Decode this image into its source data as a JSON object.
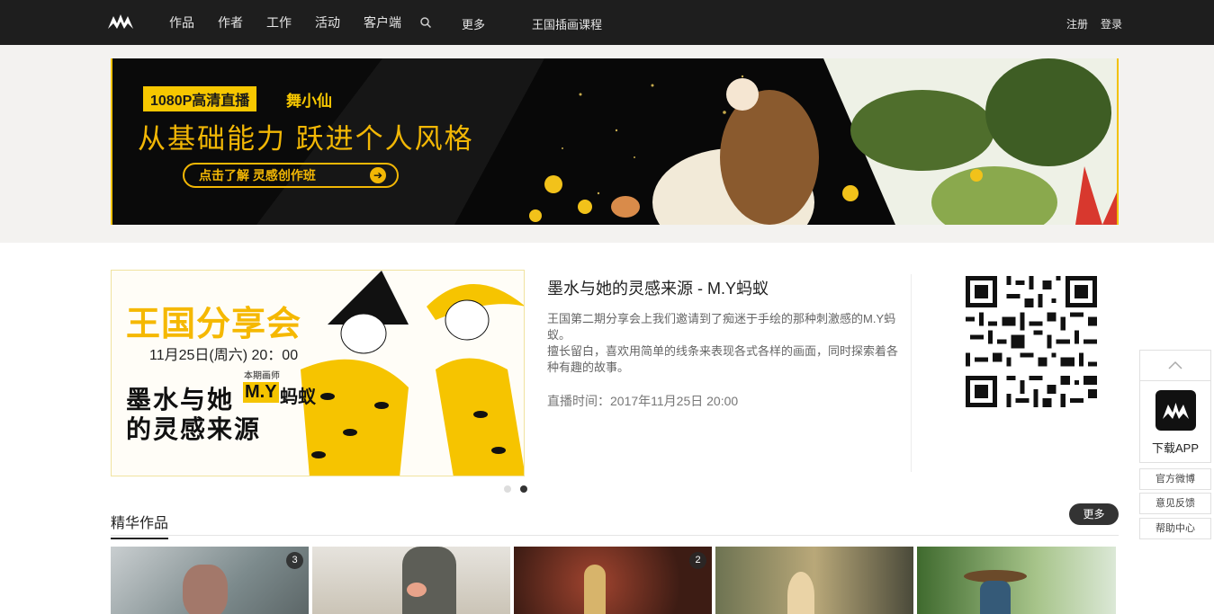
{
  "nav": {
    "logo_icon": "site-logo-icon",
    "items": [
      "作品",
      "作者",
      "工作",
      "活动",
      "客户端"
    ],
    "search_icon": "search-icon",
    "more": "更多",
    "course": "王国插画课程",
    "register": "注册",
    "login": "登录"
  },
  "banner": {
    "tag": "1080P高清直播",
    "author": "舞小仙",
    "headline": "从基础能力 跃进个人风格",
    "cta": "点击了解  灵感创作班"
  },
  "feature": {
    "image": {
      "title": "王国分享会",
      "date": "11月25日(周六) 20：00",
      "sub": "本期画师",
      "head1": "墨水与她",
      "name": "M.Y",
      "name2": "蚂蚁",
      "head2": "的灵感来源"
    },
    "title": "墨水与她的灵感来源 - M.Y蚂蚁",
    "desc1": "王国第二期分享会上我们邀请到了痴迷于手绘的那种刺激感的M.Y蚂蚁。",
    "desc2": "擅长留白，喜欢用简单的线条来表现各式各样的画面，同时探索着各种有趣的故事。",
    "time": "直播时间：2017年11月25日 20:00",
    "qr_icon": "qr-code-icon"
  },
  "section": {
    "title": "精华作品",
    "more": "更多",
    "thumbs": [
      {
        "badge": "3"
      },
      {
        "badge": ""
      },
      {
        "badge": "2"
      },
      {
        "badge": ""
      },
      {
        "badge": ""
      }
    ]
  },
  "sidebar": {
    "top_icon": "chevron-up-icon",
    "app_icon": "app-logo-icon",
    "app_label": "下载APP",
    "links": [
      "官方微博",
      "意见反馈",
      "帮助中心"
    ]
  },
  "colors": {
    "nav_bg": "#1e1e1e",
    "accent_yellow": "#f2b705",
    "banner_bg": "#f3f2f0"
  }
}
